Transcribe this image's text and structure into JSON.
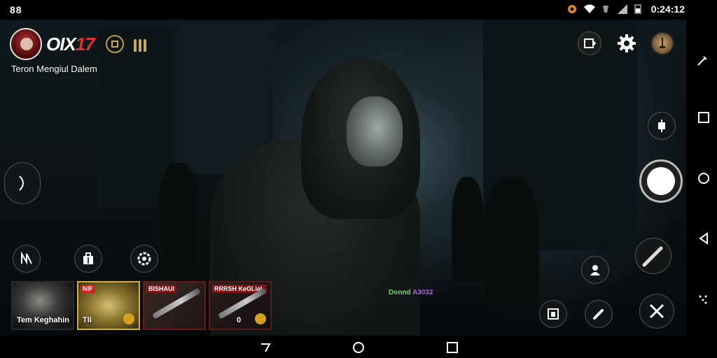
{
  "status_bar": {
    "left_text": "88",
    "time": "0:24:12"
  },
  "game": {
    "brand_name_prefix": "OIX",
    "brand_name_number": "17",
    "subtitle": "Teron Mengiul Dalem",
    "status_note_prefix": "Donnd",
    "status_note_number": "A3032"
  },
  "inventory": {
    "slots": [
      {
        "label": "Tem Keghahin",
        "tag": "",
        "count": ""
      },
      {
        "label": "TII",
        "tag": "NIF",
        "count": ""
      },
      {
        "label": "",
        "tag": "BISHAUI",
        "count": ""
      },
      {
        "label": "",
        "tag": "RRRSH KeGLiaL",
        "count": "0"
      }
    ]
  },
  "icons": {
    "battery": "battery-icon",
    "wifi": "wifi-icon",
    "signal": "signal-icon",
    "gear": "gear-icon",
    "screen": "screen-icon"
  },
  "colors": {
    "accent_red": "#e5302a",
    "gold": "#c9a95a",
    "note_green": "#7cd070",
    "note_purple": "#b060d8"
  }
}
